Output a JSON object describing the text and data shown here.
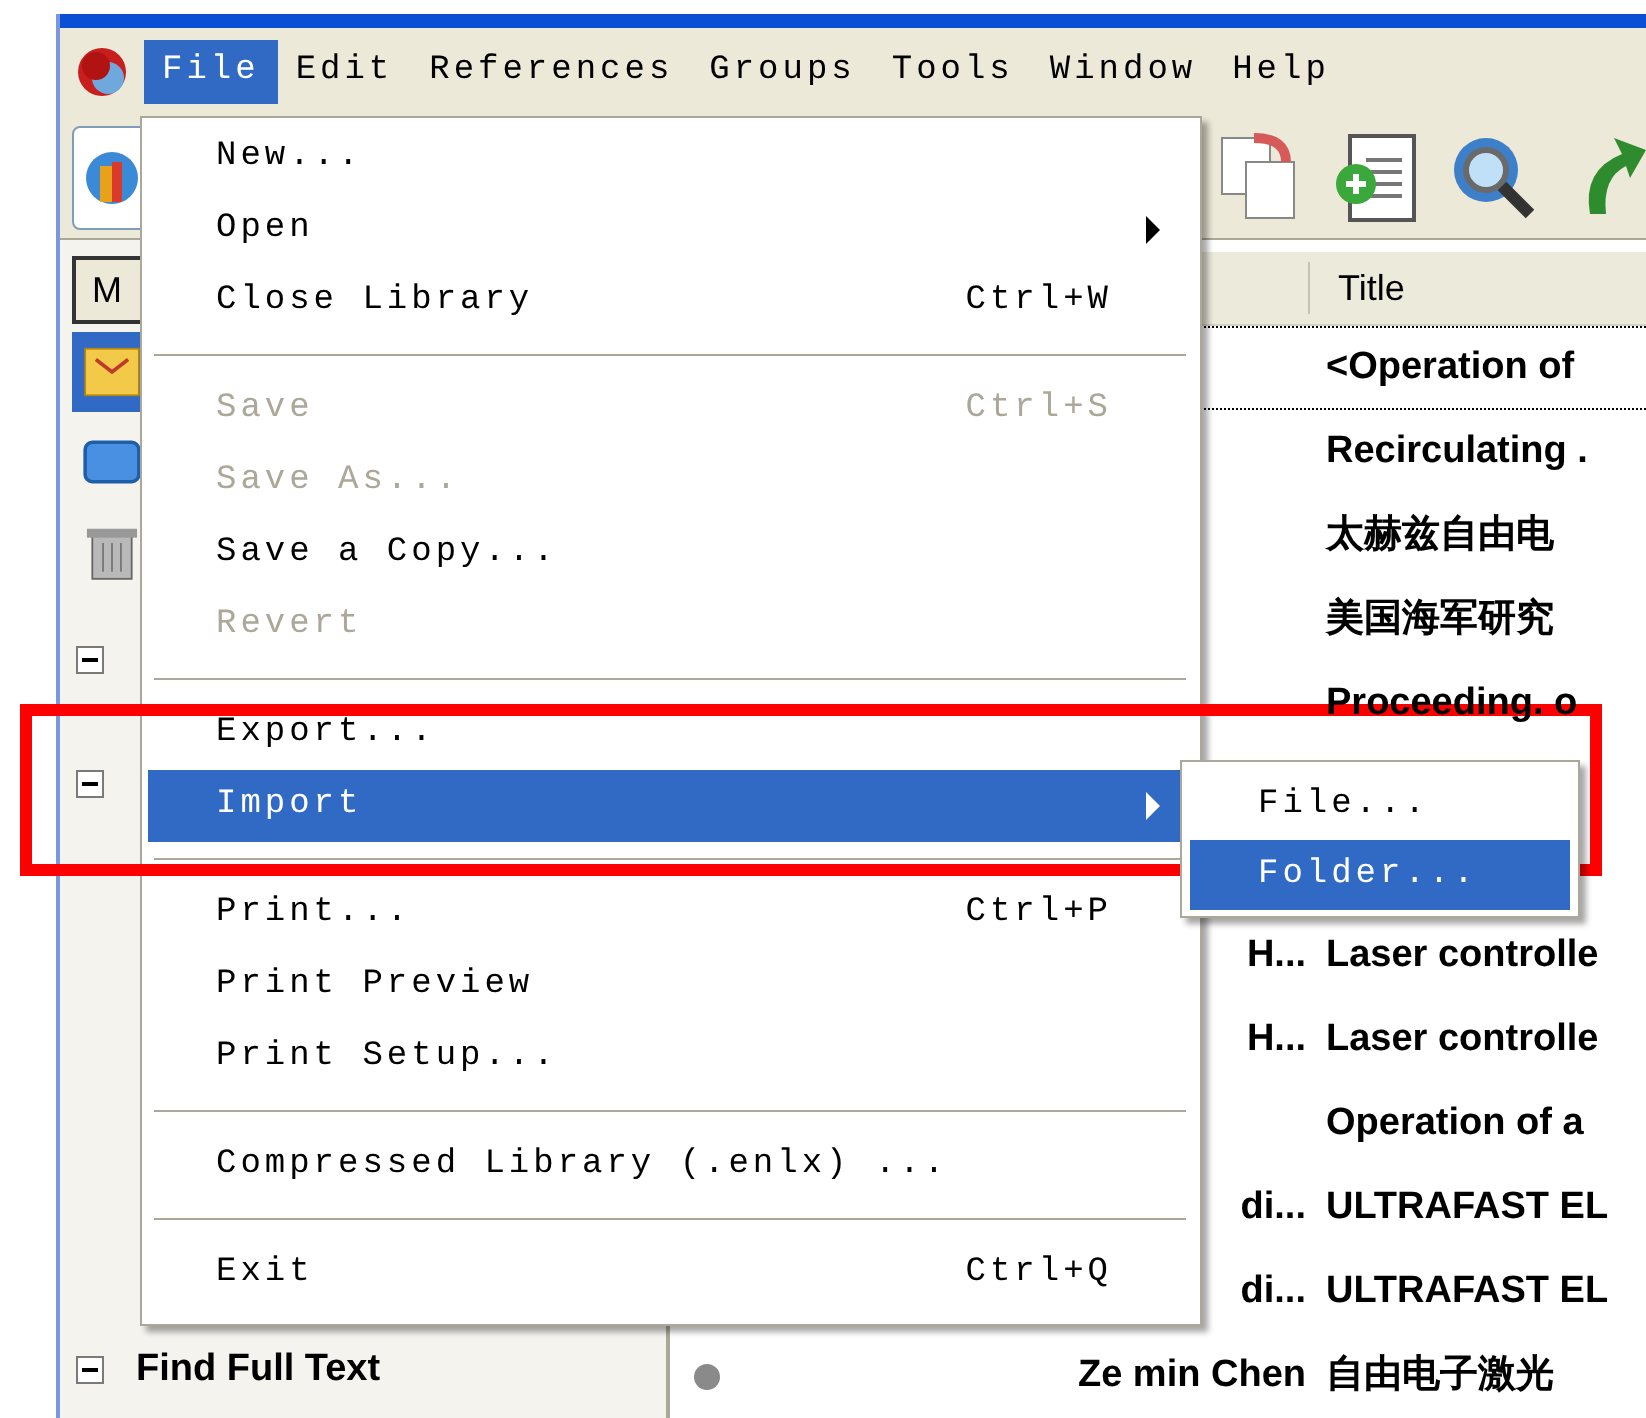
{
  "menubar": [
    {
      "label": "File",
      "selected": true
    },
    {
      "label": "Edit",
      "selected": false
    },
    {
      "label": "References",
      "selected": false
    },
    {
      "label": "Groups",
      "selected": false
    },
    {
      "label": "Tools",
      "selected": false
    },
    {
      "label": "Window",
      "selected": false
    },
    {
      "label": "Help",
      "selected": false
    }
  ],
  "sidebar": {
    "header_button": "M",
    "items": [
      {
        "kind": "folder",
        "selected": true
      },
      {
        "kind": "group",
        "selected": false
      },
      {
        "kind": "trash",
        "selected": false
      },
      {
        "kind": "collapse",
        "selected": false
      },
      {
        "kind": "collapse",
        "selected": false
      }
    ],
    "footer_group": {
      "label": "Find Full Text",
      "expanded": true
    }
  },
  "reference_list": {
    "columns": [
      "Title"
    ],
    "rows": [
      {
        "author": "",
        "title": "<Operation of",
        "dot": false
      },
      {
        "author": "",
        "title": "Recirculating .",
        "dot": false
      },
      {
        "author": "",
        "title": "太赫兹自由电",
        "dot": false
      },
      {
        "author": "",
        "title": "美国海军研究",
        "dot": false
      },
      {
        "author": "",
        "title": "Proceeding. o",
        "dot": false
      },
      {
        "author": "",
        "title": "",
        "dot": false
      },
      {
        "author": "",
        "title": "",
        "dot": false
      },
      {
        "author": "H...",
        "title": "Laser controlle",
        "dot": false
      },
      {
        "author": "H...",
        "title": "Laser controlle",
        "dot": false
      },
      {
        "author": "",
        "title": "Operation of a",
        "dot": false
      },
      {
        "author": "di...",
        "title": "ULTRAFAST EL",
        "dot": false
      },
      {
        "author": "di...",
        "title": "ULTRAFAST EL",
        "dot": false
      },
      {
        "author": "Ze min Chen",
        "title": "自由电子激光",
        "dot": true
      }
    ]
  },
  "file_menu": {
    "items": [
      {
        "kind": "item",
        "label": "New...",
        "disabled": false,
        "selected": false,
        "submenu": false
      },
      {
        "kind": "item",
        "label": "Open",
        "disabled": false,
        "selected": false,
        "submenu": true
      },
      {
        "kind": "item",
        "label": "Close Library",
        "shortcut": "Ctrl+W",
        "disabled": false,
        "selected": false,
        "submenu": false
      },
      {
        "kind": "separator"
      },
      {
        "kind": "item",
        "label": "Save",
        "shortcut": "Ctrl+S",
        "disabled": true,
        "selected": false,
        "submenu": false
      },
      {
        "kind": "item",
        "label": "Save As...",
        "disabled": true,
        "selected": false,
        "submenu": false
      },
      {
        "kind": "item",
        "label": "Save a Copy...",
        "disabled": false,
        "selected": false,
        "submenu": false
      },
      {
        "kind": "item",
        "label": "Revert",
        "disabled": true,
        "selected": false,
        "submenu": false
      },
      {
        "kind": "separator"
      },
      {
        "kind": "item",
        "label": "Export...",
        "disabled": false,
        "selected": false,
        "submenu": false
      },
      {
        "kind": "item",
        "label": "Import",
        "disabled": false,
        "selected": true,
        "submenu": true
      },
      {
        "kind": "separator"
      },
      {
        "kind": "item",
        "label": "Print...",
        "shortcut": "Ctrl+P",
        "disabled": false,
        "selected": false,
        "submenu": false
      },
      {
        "kind": "item",
        "label": "Print Preview",
        "disabled": false,
        "selected": false,
        "submenu": false
      },
      {
        "kind": "item",
        "label": "Print Setup...",
        "disabled": false,
        "selected": false,
        "submenu": false
      },
      {
        "kind": "separator"
      },
      {
        "kind": "item",
        "label": "Compressed Library (.enlx) ...",
        "disabled": false,
        "selected": false,
        "submenu": false
      },
      {
        "kind": "separator"
      },
      {
        "kind": "item",
        "label": "Exit",
        "shortcut": "Ctrl+Q",
        "disabled": false,
        "selected": false,
        "submenu": false
      }
    ]
  },
  "import_submenu": {
    "items": [
      {
        "label": "File...",
        "selected": false
      },
      {
        "label": "Folder...",
        "selected": true
      }
    ]
  }
}
